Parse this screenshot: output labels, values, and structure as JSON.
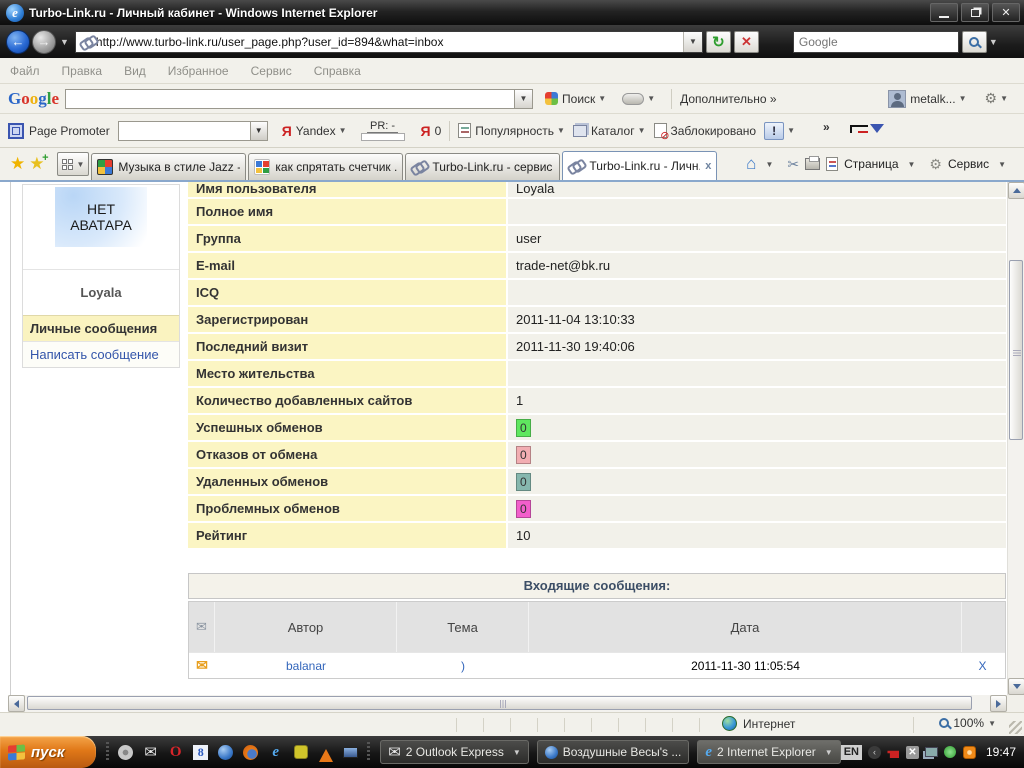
{
  "window": {
    "title": "Turbo-Link.ru - Личный кабинет - Windows Internet Explorer"
  },
  "nav": {
    "url": "http://www.turbo-link.ru/user_page.php?user_id=894&what=inbox",
    "search_placeholder": "Google"
  },
  "menubar": {
    "items": [
      "Файл",
      "Правка",
      "Вид",
      "Избранное",
      "Сервис",
      "Справка"
    ]
  },
  "google_toolbar": {
    "logo": [
      {
        "ch": "G",
        "color": "#2a66c8"
      },
      {
        "ch": "o",
        "color": "#d8342a"
      },
      {
        "ch": "o",
        "color": "#eeb211"
      },
      {
        "ch": "g",
        "color": "#2a66c8"
      },
      {
        "ch": "l",
        "color": "#2f9e44"
      },
      {
        "ch": "e",
        "color": "#d8342a"
      }
    ],
    "search_button": "Поиск",
    "more_button": "Дополнительно »",
    "account": "metalk..."
  },
  "promoter_toolbar": {
    "name": "Page Promoter",
    "ya_letter": "Я",
    "yandex": "Yandex",
    "pr": "PR: -",
    "ya_count": "0",
    "popularity": "Популярность",
    "catalog": "Каталог",
    "blocked": "Заблокировано",
    "warn": "!",
    "overflow": "»"
  },
  "tabbar": {
    "tabs": [
      {
        "title": "Музыка в стиле Jazz - ..."
      },
      {
        "title": "как спрятать счетчик ..."
      },
      {
        "title": "Turbo-Link.ru - сервис д..."
      },
      {
        "title": "Turbo-Link.ru - Личн...",
        "close": "x"
      }
    ],
    "page_button": "Страница",
    "tools_button": "Сервис"
  },
  "sidebar": {
    "avatar_line1": "НЕТ",
    "avatar_line2": "АВАТАРА",
    "username": "Loyala",
    "messages_item": "Личные сообщения",
    "write_item": "Написать сообщение"
  },
  "profile": {
    "rows": [
      {
        "label": "Имя пользователя",
        "value": "Loyala"
      },
      {
        "label": "Полное имя",
        "value": ""
      },
      {
        "label": "Группа",
        "value": "user"
      },
      {
        "label": "E-mail",
        "value": "trade-net@bk.ru"
      },
      {
        "label": "ICQ",
        "value": ""
      },
      {
        "label": "Зарегистрирован",
        "value": "2011-11-04 13:10:33"
      },
      {
        "label": "Последний визит",
        "value": "2011-11-30 19:40:06"
      },
      {
        "label": "Место жительства",
        "value": ""
      },
      {
        "label": "Количество добавленных сайтов",
        "value": "1"
      },
      {
        "label": "Успешных обменов",
        "value": "0",
        "badge": "#5fe75f"
      },
      {
        "label": "Отказов от обмена",
        "value": "0",
        "badge": "#f2aeb2"
      },
      {
        "label": "Удаленных обменов",
        "value": "0",
        "badge": "#86b7ae"
      },
      {
        "label": "Проблемных обменов",
        "value": "0",
        "badge": "#f25ecb"
      },
      {
        "label": "Рейтинг",
        "value": "10"
      }
    ]
  },
  "messages": {
    "title": "Входящие сообщения:",
    "col_author": "Автор",
    "col_subject": "Тема",
    "col_date": "Дата",
    "rows": [
      {
        "author": "balanar",
        "subject": ")",
        "date": "2011-11-30 11:05:54",
        "delete_label": "X"
      }
    ]
  },
  "statusbar": {
    "zone": "Интернет",
    "zoom": "100%"
  },
  "taskbar": {
    "start": "пуск",
    "buttons": [
      {
        "label": "2 Outlook Express"
      },
      {
        "label": "Воздушные Весы's ..."
      },
      {
        "label": "2 Internet Explorer"
      }
    ],
    "lang": "EN",
    "time": "19:47"
  }
}
